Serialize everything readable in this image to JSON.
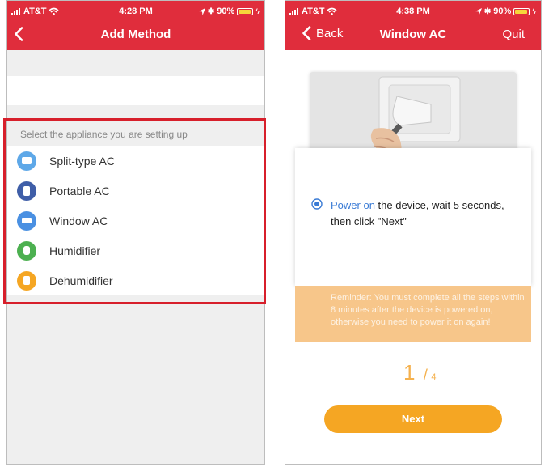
{
  "status_left": {
    "carrier": "AT&T",
    "time": "4:28 PM",
    "battery": "90%"
  },
  "status_right": {
    "carrier": "AT&T",
    "time": "4:38 PM",
    "battery": "90%"
  },
  "screen1": {
    "title": "Add Method",
    "prompt": "Select the appliance you are setting up",
    "appliances": [
      {
        "label": "Split-type AC",
        "icon": "split-ac-icon",
        "color": "#5ea8e8"
      },
      {
        "label": "Portable AC",
        "icon": "portable-ac-icon",
        "color": "#3f5ea8"
      },
      {
        "label": "Window AC",
        "icon": "window-ac-icon",
        "color": "#4a90e2"
      },
      {
        "label": "Humidifier",
        "icon": "humidifier-icon",
        "color": "#4cb050"
      },
      {
        "label": "Dehumidifier",
        "icon": "dehumidifier-icon",
        "color": "#f5a623"
      }
    ]
  },
  "screen2": {
    "back_label": "Back",
    "title": "Window AC",
    "quit_label": "Quit",
    "instruction_highlight": "Power on",
    "instruction_line1_rest": " the device, wait 5 seconds,",
    "instruction_line2": "then click \"Next\"",
    "reminder": "Reminder: You must complete all the steps within 8 minutes after the device is powered on, otherwise you need to power it on again!",
    "step_current": "1",
    "step_sep": "/",
    "step_total": "4",
    "next_label": "Next"
  },
  "colors": {
    "accent_red": "#e02d3c",
    "highlight_box": "#d71f2b",
    "orange": "#f5a623",
    "link_blue": "#3a7bd5"
  }
}
